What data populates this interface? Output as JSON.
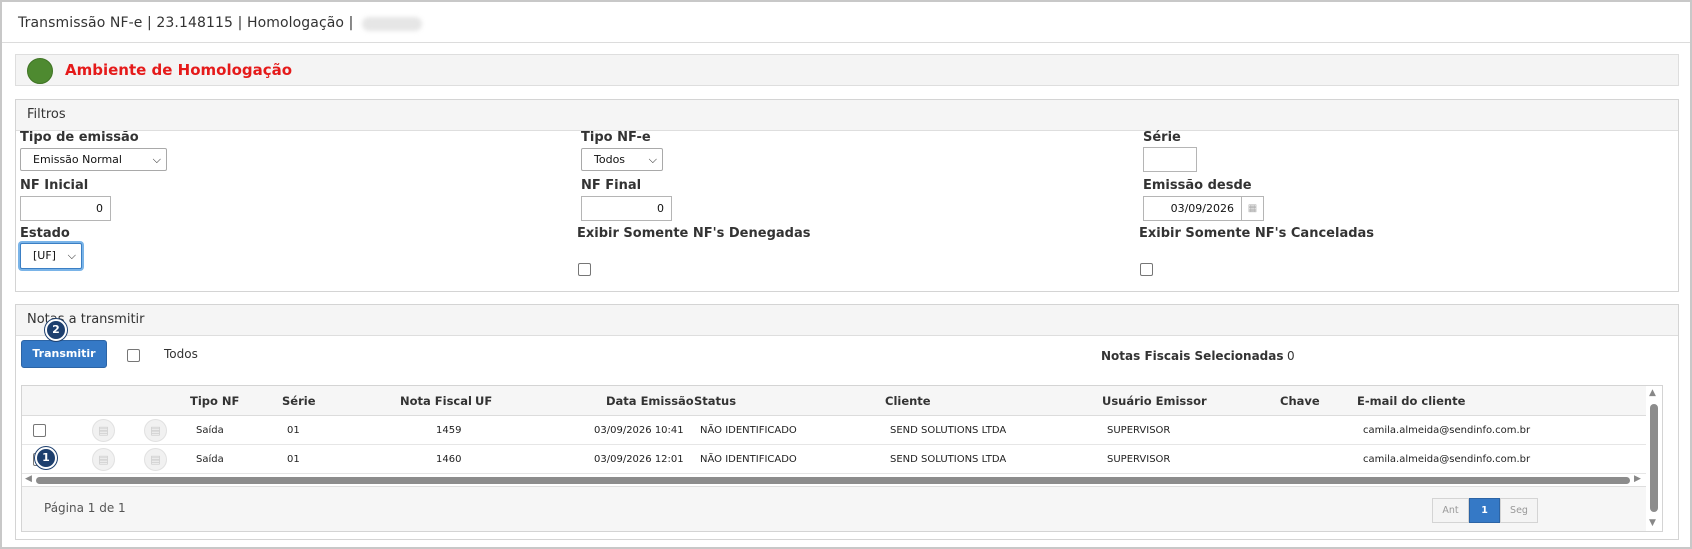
{
  "window": {
    "title": "Transmissão NF-e | 23.148115 | Homologação |"
  },
  "environment": {
    "label": "Ambiente de Homologação",
    "indicator_color": "#4e8a30",
    "label_color": "#e51a1a"
  },
  "filters": {
    "panel_title": "Filtros",
    "tipo_emissao": {
      "label": "Tipo de emissão",
      "value": "Emissão Normal"
    },
    "tipo_nfe": {
      "label": "Tipo NF-e",
      "value": "Todos"
    },
    "serie": {
      "label": "Série",
      "value": ""
    },
    "nf_inicial": {
      "label": "NF Inicial",
      "value": "0"
    },
    "nf_final": {
      "label": "NF Final",
      "value": "0"
    },
    "emissao_desde": {
      "label": "Emissão desde",
      "value": "03/09/2026"
    },
    "estado": {
      "label": "Estado",
      "value": "[UF]"
    },
    "somente_denegadas": {
      "label": "Exibir Somente NF's Denegadas",
      "checked": false
    },
    "somente_canceladas": {
      "label": "Exibir Somente NF's Canceladas",
      "checked": false
    }
  },
  "notas": {
    "panel_title": "Notas a transmitir",
    "transmit_label": "Transmitir",
    "todos_label": "Todos",
    "selected_label": "Notas Fiscais Selecionadas",
    "selected_count": "0",
    "badges": {
      "step1": "1",
      "step2": "2"
    },
    "columns": {
      "tipo_nf": "Tipo NF",
      "serie": "Série",
      "nota_fiscal": "Nota Fiscal",
      "uf": "UF",
      "data_emissao": "Data Emissão",
      "status": "Status",
      "cliente": "Cliente",
      "usuario_emissor": "Usuário Emissor",
      "chave": "Chave",
      "email_cliente": "E-mail do cliente"
    },
    "rows": [
      {
        "tipo_nf": "Saída",
        "serie": "01",
        "nota_fiscal": "1459",
        "uf": "",
        "data_emissao": "03/09/2026 10:41",
        "status": "NÃO IDENTIFICADO",
        "cliente": "SEND SOLUTIONS LTDA",
        "usuario_emissor": "SUPERVISOR",
        "chave": "",
        "email_cliente": "camila.almeida@sendinfo.com.br"
      },
      {
        "tipo_nf": "Saída",
        "serie": "01",
        "nota_fiscal": "1460",
        "uf": "",
        "data_emissao": "03/09/2026 12:01",
        "status": "NÃO IDENTIFICADO",
        "cliente": "SEND SOLUTIONS LTDA",
        "usuario_emissor": "SUPERVISOR",
        "chave": "",
        "email_cliente": "camila.almeida@sendinfo.com.br"
      }
    ],
    "pagination": {
      "page_text": "Página 1 de 1",
      "prev_label": "Ant",
      "current_page": "1",
      "next_label": "Seg"
    }
  }
}
